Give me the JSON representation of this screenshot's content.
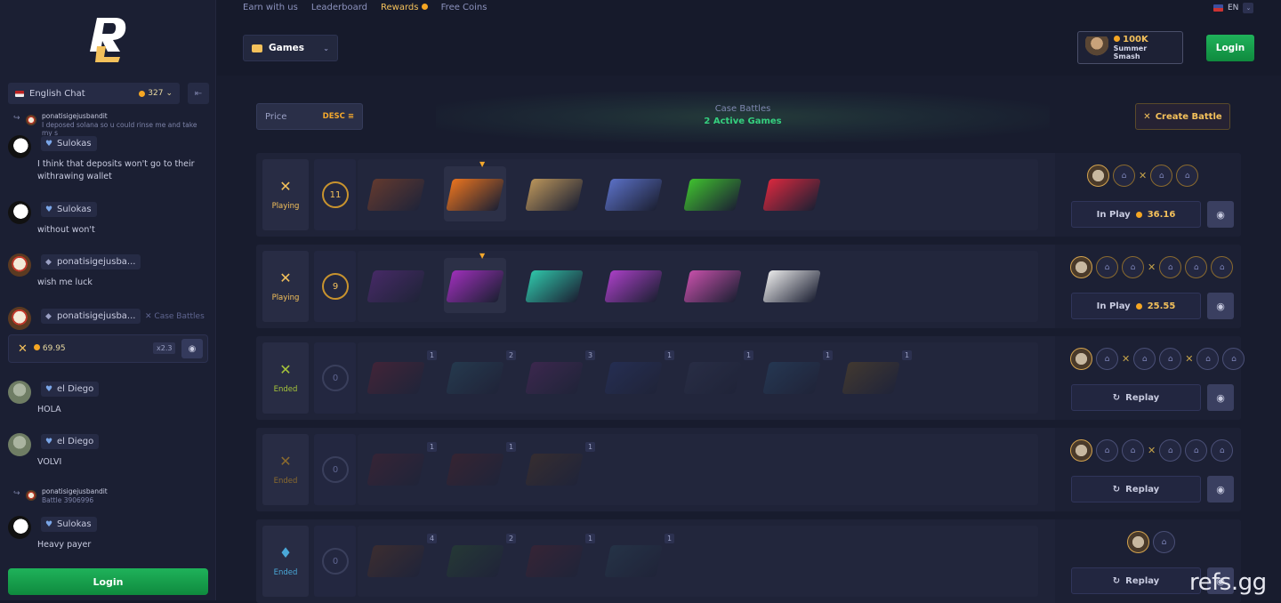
{
  "nav": {
    "links": [
      "Earn with us",
      "Leaderboard",
      "Rewards",
      "Free Coins"
    ],
    "language": "EN",
    "games_label": "Games",
    "promo_amount": "100K",
    "promo_name": "Summer Smash",
    "login_label": "Login"
  },
  "chat": {
    "room": "English Chat",
    "online": "327",
    "messages": [
      {
        "user": "ponatisigejusbandit",
        "text": "I deposed solana so u could rinse me and take my s"
      },
      {
        "user": "Sulokas",
        "text": "I think that deposits won't go to their withrawing wallet"
      },
      {
        "user": "Sulokas",
        "text": "without won't"
      },
      {
        "user": "ponatisigejusba...",
        "text": "wish me luck"
      },
      {
        "user": "ponatisigejusba...",
        "tag": "Case Battles",
        "amount": "69.95",
        "multiplier": "x2.3"
      },
      {
        "user": "el Diego",
        "text": "HOLA"
      },
      {
        "user": "el Diego",
        "text": "VOLVI"
      },
      {
        "user": "ponatisigejusbandit",
        "text": "Battle 3906996"
      },
      {
        "user": "Sulokas",
        "text": "Heavy payer"
      }
    ],
    "login_label": "Login"
  },
  "battles": {
    "sort_label": "Price",
    "sort_dir": "DESC",
    "title": "Case Battles",
    "subtitle": "2 Active Games",
    "create_label": "Create Battle",
    "rows": [
      {
        "status": "Playing",
        "round": "11",
        "action": "In Play",
        "value": "36.16"
      },
      {
        "status": "Playing",
        "round": "9",
        "action": "In Play",
        "value": "25.55"
      },
      {
        "status": "Ended",
        "round": "0",
        "action": "Replay",
        "badges": [
          "1",
          "2",
          "3",
          "1",
          "1",
          "1",
          "1"
        ]
      },
      {
        "status": "Ended",
        "round": "0",
        "action": "Replay",
        "badges": [
          "1",
          "1",
          "1"
        ]
      },
      {
        "status": "Ended",
        "round": "0",
        "action": "Replay",
        "badges": [
          "4",
          "2",
          "1",
          "1"
        ]
      }
    ]
  },
  "colors": {
    "accent": "#f4c15b",
    "green": "#1fb25a",
    "active": "#35d07f"
  },
  "watermark": "refs.gg"
}
